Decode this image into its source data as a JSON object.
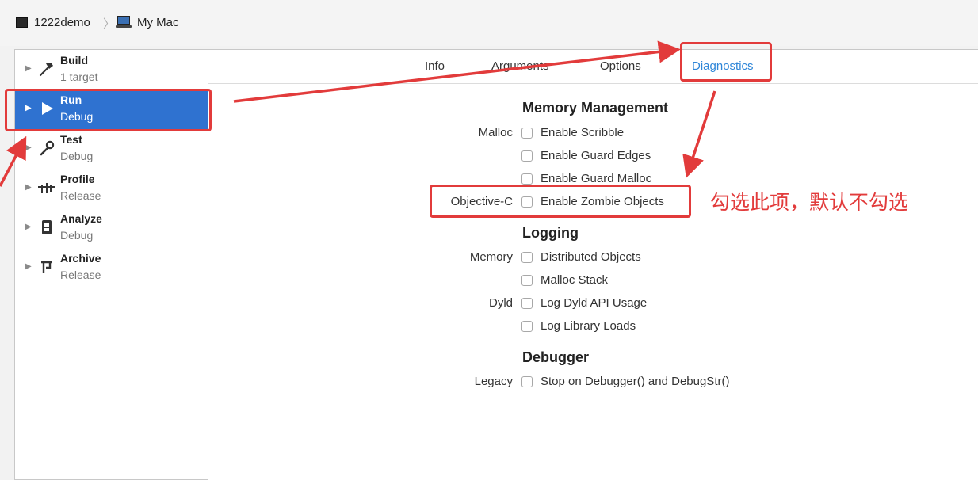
{
  "breadcrumb": {
    "project": "1222demo",
    "separator": "〉",
    "device": "My Mac"
  },
  "sidebar": {
    "items": [
      {
        "title": "Build",
        "subtitle": "1 target",
        "icon": "hammer-icon",
        "selected": false
      },
      {
        "title": "Run",
        "subtitle": "Debug",
        "icon": "play-icon",
        "selected": true
      },
      {
        "title": "Test",
        "subtitle": "Debug",
        "icon": "wrench-icon",
        "selected": false
      },
      {
        "title": "Profile",
        "subtitle": "Release",
        "icon": "profile-icon",
        "selected": false
      },
      {
        "title": "Analyze",
        "subtitle": "Debug",
        "icon": "analyze-icon",
        "selected": false
      },
      {
        "title": "Archive",
        "subtitle": "Release",
        "icon": "archive-icon",
        "selected": false
      }
    ],
    "selected_color": "#2f72d0"
  },
  "tabs": [
    {
      "label": "Info",
      "active": false
    },
    {
      "label": "Arguments",
      "active": false
    },
    {
      "label": "Options",
      "active": false
    },
    {
      "label": "Diagnostics",
      "active": true
    }
  ],
  "sections": {
    "memory_management": {
      "title": "Memory Management",
      "malloc_label": "Malloc",
      "options": [
        "Enable Scribble",
        "Enable Guard Edges",
        "Enable Guard Malloc"
      ],
      "objc_label": "Objective-C",
      "objc_option": "Enable Zombie Objects"
    },
    "logging": {
      "title": "Logging",
      "memory_label": "Memory",
      "memory_options": [
        "Distributed Objects",
        "Malloc Stack"
      ],
      "dyld_label": "Dyld",
      "dyld_options": [
        "Log Dyld API Usage",
        "Log Library Loads"
      ]
    },
    "debugger": {
      "title": "Debugger",
      "legacy_label": "Legacy",
      "legacy_option": "Stop on Debugger() and DebugStr()"
    }
  },
  "annotation": {
    "note": "勾选此项，默认不勾选",
    "color": "#e23b3b"
  }
}
